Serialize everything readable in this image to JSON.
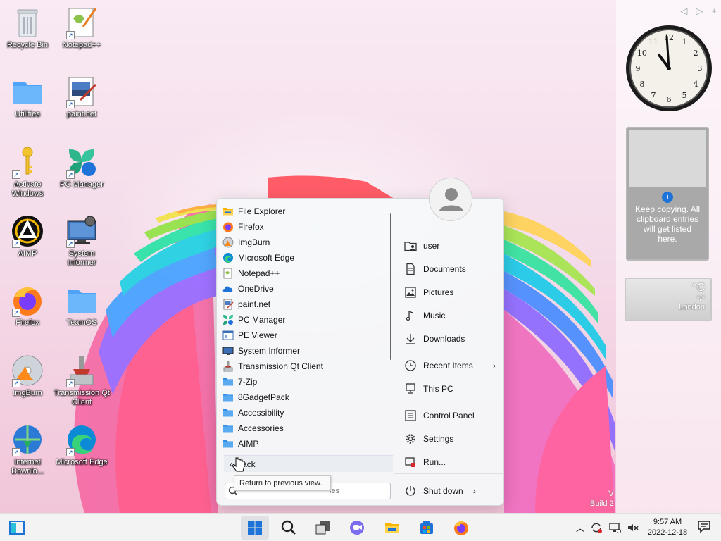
{
  "desktop": {
    "icons": [
      {
        "label": "Recycle Bin",
        "icon": "recycle-bin-icon"
      },
      {
        "label": "Notepad++",
        "icon": "notepadpp-icon",
        "shortcut": true
      },
      {
        "label": "Utilities",
        "icon": "folder-icon"
      },
      {
        "label": "paint.net",
        "icon": "paintnet-icon",
        "shortcut": true
      },
      {
        "label": "Activate Windows",
        "icon": "key-icon",
        "shortcut": true
      },
      {
        "label": "PC Manager",
        "icon": "pc-manager-icon",
        "shortcut": true
      },
      {
        "label": "AIMP",
        "icon": "aimp-icon",
        "shortcut": true
      },
      {
        "label": "System Informer",
        "icon": "system-informer-icon",
        "shortcut": true
      },
      {
        "label": "Firefox",
        "icon": "firefox-icon",
        "shortcut": true
      },
      {
        "label": "TeamOS",
        "icon": "folder-icon"
      },
      {
        "label": "ImgBurn",
        "icon": "imgburn-icon",
        "shortcut": true
      },
      {
        "label": "Transmission Qt Client",
        "icon": "transmission-icon",
        "shortcut": true
      },
      {
        "label": "Internet Downlo...",
        "icon": "idm-icon",
        "shortcut": true
      },
      {
        "label": "Microsoft Edge",
        "icon": "edge-icon",
        "shortcut": true
      }
    ]
  },
  "start_menu": {
    "programs": [
      {
        "label": "File Explorer",
        "icon": "file-explorer-icon"
      },
      {
        "label": "Firefox",
        "icon": "firefox-icon"
      },
      {
        "label": "ImgBurn",
        "icon": "imgburn-icon"
      },
      {
        "label": "Microsoft Edge",
        "icon": "edge-icon"
      },
      {
        "label": "Notepad++",
        "icon": "notepadpp-icon"
      },
      {
        "label": "OneDrive",
        "icon": "onedrive-icon"
      },
      {
        "label": "paint.net",
        "icon": "paintnet-icon"
      },
      {
        "label": "PC Manager",
        "icon": "pc-manager-icon"
      },
      {
        "label": "PE Viewer",
        "icon": "pe-viewer-icon"
      },
      {
        "label": "System Informer",
        "icon": "system-informer-icon"
      },
      {
        "label": "Transmission Qt Client",
        "icon": "transmission-icon"
      },
      {
        "label": "7-Zip",
        "icon": "folder-icon"
      },
      {
        "label": "8GadgetPack",
        "icon": "folder-icon"
      },
      {
        "label": "Accessibility",
        "icon": "folder-icon"
      },
      {
        "label": "Accessories",
        "icon": "folder-icon"
      },
      {
        "label": "AIMP",
        "icon": "folder-icon"
      }
    ],
    "back_label": "Back",
    "tooltip": "Return to previous view.",
    "search_placeholder": "les",
    "right_items": [
      {
        "label": "user",
        "icon": "user-folder-icon"
      },
      {
        "label": "Documents",
        "icon": "document-icon"
      },
      {
        "label": "Pictures",
        "icon": "picture-icon"
      },
      {
        "label": "Music",
        "icon": "music-icon"
      },
      {
        "label": "Downloads",
        "icon": "download-icon"
      },
      {
        "label": "Recent Items",
        "icon": "clock-icon",
        "submenu": true
      },
      {
        "label": "This PC",
        "icon": "computer-icon"
      },
      {
        "label": "Control Panel",
        "icon": "control-panel-icon"
      },
      {
        "label": "Settings",
        "icon": "gear-icon"
      },
      {
        "label": "Run...",
        "icon": "run-icon"
      }
    ],
    "shutdown_label": "Shut down"
  },
  "gadgets": {
    "clock": {
      "numerals": [
        "12",
        "1",
        "2",
        "3",
        "4",
        "5",
        "6",
        "7",
        "8",
        "9",
        "10",
        "11"
      ]
    },
    "clipboard": {
      "info_glyph": "i",
      "message": "Keep copying. All clipboard entries will get listed here."
    },
    "weather": {
      "temp": "°C",
      "condition": "*/*",
      "city": "London"
    }
  },
  "build_text": {
    "line1": "V",
    "line2": "Build 2"
  },
  "taskbar": {
    "time": "9:57 AM",
    "date": "2022-12-18"
  },
  "colors": {
    "accent": "#1e73d8",
    "folder": "#f7c948",
    "taskbar": "#f3f3f3"
  }
}
